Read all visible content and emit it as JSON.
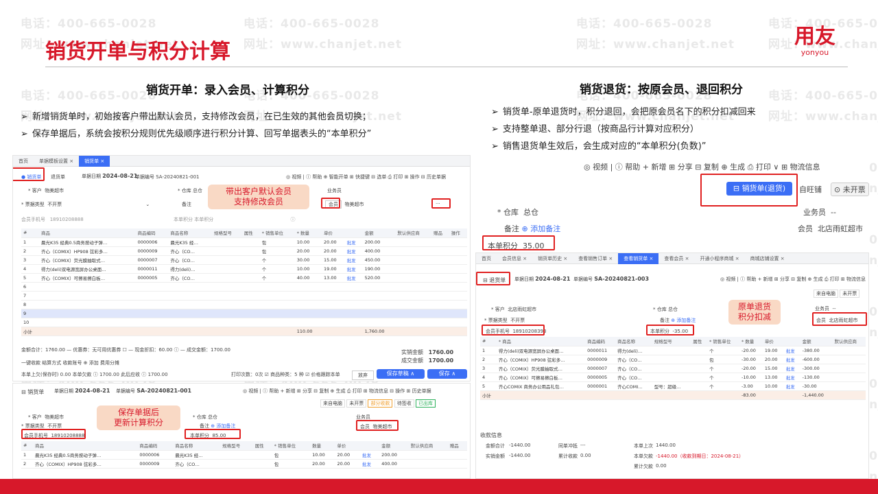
{
  "watermark": {
    "phone": "电话：400-665-0028",
    "site": "网址：www.chanjet.net"
  },
  "page": {
    "title": "销货开单与积分计算"
  },
  "logo": {
    "main": "用友",
    "sub": "yonyou"
  },
  "left": {
    "heading": "销货开单：录入会员、计算积分",
    "bullets": [
      "新增销货单时，初始按客户带出默认会员，支持修改会员，在已生效的其他会员切换；",
      "保存单据后，系统会按积分规则优先级顺序进行积分计算、回写单据表头的“本单积分”"
    ],
    "shot1": {
      "tabs": [
        "首页",
        "单据模板设置 ×",
        "销货单 ×"
      ],
      "doc_tab": "销货单",
      "doc_tab2": "退货单",
      "date_label": "单据日期",
      "date": "2024-08-21",
      "no_label": "单据编号",
      "no": "SA-20240821-001",
      "toolbar": "◎ 视频 | ⓘ 帮助  ⊕ 智能开单  ⊞ 快捷键  ⊟ 选单  ⎙ 打印  ⊞ 操作  ⊟ 历史单据",
      "customer_label": "* 客户",
      "customer": "物美超市",
      "ticket_label": "* 票据类型",
      "ticket": "不开票",
      "member_phone_label": "会员手机号",
      "member_phone_ph": "18910208888",
      "warehouse_label": "* 仓库",
      "warehouse": "总仓",
      "remark_label": "备注",
      "points_label": "本单积分",
      "points_ph": "本单积分",
      "salesman_label": "业务员",
      "member_label": "会员",
      "member": "物美超市",
      "more": "···",
      "callout": "带出客户默认会员\n支持修改会员",
      "headers": [
        "#",
        "商品",
        "商品编码",
        "商品名称",
        "规格型号",
        "属性",
        "* 销售单位",
        "* 数量",
        "单价",
        "",
        "金额",
        "默认供应商",
        "赠品",
        "操作"
      ],
      "rows": [
        [
          "1",
          "晨光K35 经典0.5商务按动子弹…",
          "0000006",
          "晨光K35 经…",
          "",
          "",
          "包",
          "10.00",
          "20.00",
          "批发",
          "200.00"
        ],
        [
          "2",
          "齐心（COMIX）HP908 弦彩多…",
          "0000009",
          "齐心（CO…",
          "",
          "",
          "包",
          "20.00",
          "20.00",
          "批发",
          "400.00"
        ],
        [
          "3",
          "齐心（COMIX）荧光膜抽取式…",
          "0000007",
          "齐心（CO…",
          "",
          "",
          "个",
          "30.00",
          "15.00",
          "批发",
          "450.00"
        ],
        [
          "4",
          "得力(deli)双电源宽屏办公桌面…",
          "0000011",
          "得力(deli)…",
          "",
          "",
          "个",
          "10.00",
          "19.00",
          "批发",
          "190.00"
        ],
        [
          "5",
          "齐心（COMIX）可擦易擦白板…",
          "0000005",
          "齐心（CO…",
          "",
          "",
          "个",
          "40.00",
          "13.00",
          "批发",
          "520.00"
        ],
        [
          "6"
        ],
        [
          "7"
        ],
        [
          "8"
        ],
        [
          "9"
        ],
        [
          "10"
        ]
      ],
      "total_label": "小计",
      "total_qty": "110.00",
      "total_amount": "1,760.00",
      "sum_line": "金额合计：1760.00  —  优惠券：无可用优惠券  ☐ — 现金折扣：60.00   ⓘ — 成交金额：1700.00",
      "settle_line": "一键收款 结算方式  收款账号   ⊕ 添加  费用分摊",
      "recv_label": "实销金额",
      "recv": "1760.00",
      "deal_label": "成交金额",
      "deal": "1700.00",
      "bottom_line": "本单上欠(保存时) 0.00  本单欠款 ⓘ 1700.00  此后应收 ⓘ 1700.00",
      "print_line": "打印次数：0次  ☑ 商品种类：5 种  ☑ 价格跟踪本单",
      "btn_abandon": "放弃",
      "btn_draft": "保存草稿 ∧",
      "btn_save": "保存 ∧"
    },
    "shot2": {
      "doc_tab": "销货单",
      "date_label": "单据日期",
      "date": "2024-08-21",
      "no_label": "单据编号",
      "no": "SA-20240821-001",
      "toolbar": "◎ 视频 | ⓘ 帮助  + 新增  ⊞ 分享  ⊟ 复制  ⊕ 生成  ⎙ 打印  ⊞ 物流信息  ⊟ 操作  ⊞ 历史单据",
      "status": [
        "来自电脑",
        "未开票",
        "部分收款",
        "待签收",
        "已出库"
      ],
      "customer_label": "* 客户",
      "customer": "物美超市",
      "ticket_label": "* 票据类型",
      "ticket": "不开票",
      "member_phone_label": "会员手机号",
      "member_phone": "18910208888",
      "warehouse_label": "* 仓库",
      "warehouse": "总仓",
      "remark_label": "备注",
      "add_remark": "添加备注",
      "points_label": "本单积分",
      "points": "85.00",
      "salesman_label": "业务员",
      "member_label": "会员",
      "member": "物美超市",
      "callout": "保存单据后\n更新计算积分",
      "headers": [
        "#",
        "商品",
        "商品编码",
        "商品名称",
        "规格型号",
        "属性",
        "* 销售单位",
        "数量",
        "单价",
        "",
        "金额",
        "默认供应商",
        "赠品"
      ],
      "rows": [
        [
          "1",
          "晨光K35 经典0.5商务按动子弹…",
          "0000006",
          "晨光K35 经…",
          "",
          "",
          "包",
          "10.00",
          "20.00",
          "批发",
          "200.00"
        ],
        [
          "2",
          "齐心（COMIX）HP908 弦彩多…",
          "0000009",
          "齐心（CO…",
          "",
          "",
          "包",
          "20.00",
          "20.00",
          "批发",
          "400.00"
        ]
      ]
    }
  },
  "right": {
    "heading": "销货退货：按原会员、退回积分",
    "bullets": [
      "销货单-原单退货时，积分退回，会把原会员名下的积分扣减回来",
      "支持整单退、部分行退（按商品行计算对应积分）",
      "销售退货单生效后，会生成对应的“本单积分(负数)”"
    ],
    "zoom": {
      "toolbar": "◎ 视频 | ⓘ 帮助  + 新增  ⊞ 分享  ⊟ 复制  ⊕ 生成  ⎙ 打印 ∨  ⊞ 物流信息",
      "btn_doc": "销货单(退货)",
      "btn_store": "自旺铺",
      "btn_invoice": "未开票",
      "warehouse_label": "* 仓库",
      "warehouse": "总仓",
      "remark_label": "备注",
      "add_remark": "添加备注",
      "salesman_label": "业务员",
      "salesman": "--",
      "member_label": "会员",
      "member": "北店雨虹超市",
      "points_label": "本单积分",
      "points": "35.00"
    },
    "shot3": {
      "tabs": [
        "首页",
        "会员信息 ×",
        "销货单历史 ×",
        "查看销售订单 ×",
        "查看销货单 ×",
        "查看会员 ×",
        "开通小程序商城 ×",
        "商城店铺设置 ×"
      ],
      "doc_tab": "退货单",
      "date_label": "单据日期",
      "date": "2024-08-21",
      "no_label": "单据编号",
      "no": "SA-20240821-003",
      "toolbar": "◎ 视频 | ⓘ 帮助  + 新增  ⊞ 分享  ⊟ 复制  ⊕ 生成  ⎙ 打印  ⊞ 物流信息",
      "status": [
        "来自电脑",
        "未开票"
      ],
      "customer_label": "* 客户",
      "customer": "北店雨虹超市",
      "ticket_label": "* 票据类型",
      "ticket": "不开票",
      "member_phone_label": "会员手机号",
      "member_phone": "18910208393",
      "warehouse_label": "* 仓库",
      "warehouse": "总仓",
      "remark_label": "备注",
      "add_remark": "添加备注",
      "points_label": "本单积分",
      "points": "-35.00",
      "salesman_label": "业务员",
      "salesman": "--",
      "member_label": "会员",
      "member": "北店雨虹超市",
      "callout": "原单退货\n积分扣减",
      "headers": [
        "#",
        "* 商品",
        "商品编码",
        "商品名称",
        "规格型号",
        "属性",
        "* 销售单位",
        "* 数量",
        "单价",
        "",
        "金额",
        "默认供应商"
      ],
      "rows": [
        [
          "1",
          "得力(deli)双电源宽屏办公桌面…",
          "0000011",
          "得力(deli)…",
          "",
          "",
          "个",
          "-20.00",
          "19.00",
          "批发",
          "-380.00"
        ],
        [
          "2",
          "齐心（COMIX）HP908 弦彩多…",
          "0000009",
          "齐心（CO…",
          "",
          "",
          "包",
          "-30.00",
          "20.00",
          "批发",
          "-600.00"
        ],
        [
          "3",
          "齐心（COMIX）荧光膜抽取式…",
          "0000007",
          "齐心（CO…",
          "",
          "",
          "个",
          "-20.00",
          "15.00",
          "批发",
          "-300.00"
        ],
        [
          "4",
          "齐心（COMIX）可擦易擦白板…",
          "0000005",
          "齐心（CO…",
          "",
          "",
          "个",
          "-10.00",
          "13.00",
          "批发",
          "-130.00"
        ],
        [
          "5",
          "齐心COMIX 商务办公用品礼包…",
          "0000001",
          "齐心COMI…",
          "型号：超级…",
          "",
          "个",
          "-3.00",
          "10.00",
          "批发",
          "-30.00"
        ]
      ],
      "total_label": "小计",
      "total_qty": "-83.00",
      "total_amount": "-1,440.00",
      "info_title": "收款信息",
      "info": [
        [
          "金额合计",
          "-1440.00",
          "同单冲抵",
          "---",
          "本单上次",
          "1440.00"
        ],
        [
          "实销金额",
          "-1440.00",
          "累计收款",
          "0.00",
          "本单欠款",
          "-1440.00（收款到期日：2024-08-21）"
        ],
        [
          "",
          "",
          "",
          "",
          "累计欠款",
          "0.00"
        ]
      ]
    }
  }
}
